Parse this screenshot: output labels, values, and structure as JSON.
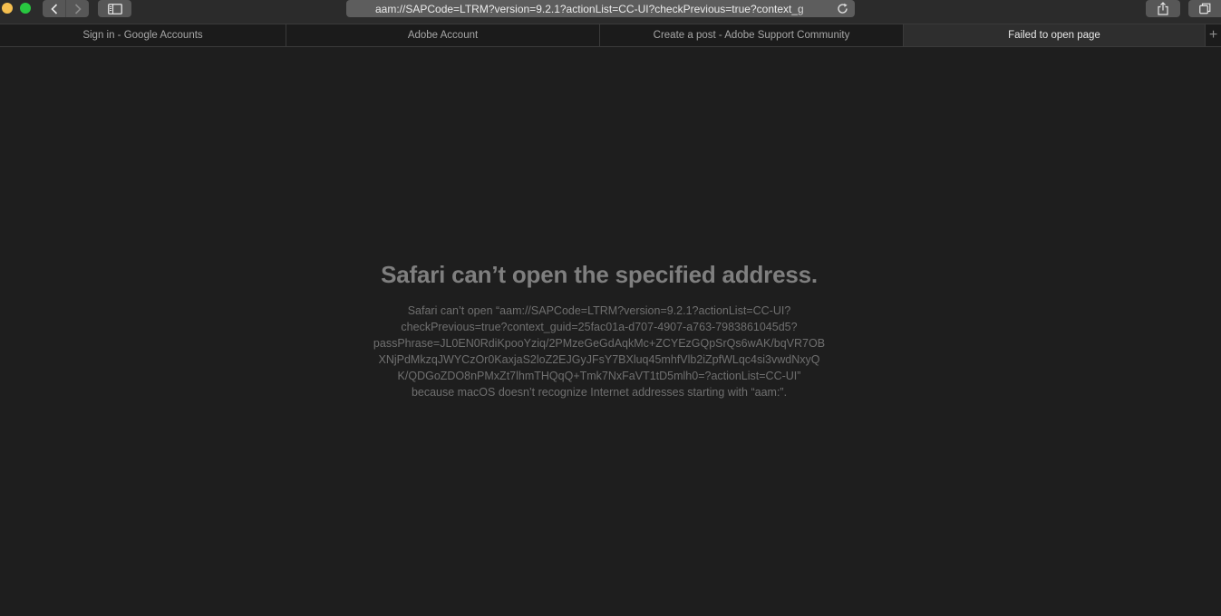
{
  "toolbar": {
    "address": "aam://SAPCode=LTRM?version=9.2.1?actionList=CC-UI?checkPrevious=true?context_g",
    "icons": {
      "back": "chevron-left-icon",
      "forward": "chevron-right-icon",
      "sidebar": "sidebar-icon",
      "reload": "reload-icon",
      "share": "share-icon",
      "tabs": "tab-overview-icon"
    }
  },
  "tabs": [
    {
      "label": "Sign in - Google Accounts",
      "active": false
    },
    {
      "label": "Adobe Account",
      "active": false
    },
    {
      "label": "Create a post - Adobe Support Community",
      "active": false
    },
    {
      "label": "Failed to open page",
      "active": true
    }
  ],
  "new_tab_label": "+",
  "error": {
    "title": "Safari can’t open the specified address.",
    "lines": [
      "Safari can’t open “aam://SAPCode=LTRM?version=9.2.1?actionList=CC-UI?",
      "checkPrevious=true?context_guid=25fac01a-d707-4907-a763-7983861045d5?",
      "passPhrase=JL0EN0RdiKpooYziq/2PMzeGeGdAqkMc+ZCYEzGQpSrQs6wAK/bqVR7OB",
      "XNjPdMkzqJWYCzOr0KaxjaS2loZ2EJGyJFsY7BXluq45mhfVlb2iZpfWLqc4si3vwdNxyQ",
      "K/QDGoZDO8nPMxZt7lhmTHQqQ+Tmk7NxFaVT1tD5mlh0=?actionList=CC-UI”",
      "because macOS doesn’t recognize Internet addresses starting with “aam:”."
    ]
  },
  "colors": {
    "background": "#1e1e1e",
    "toolbar": "#2b2b2b",
    "title_text": "#7f7f7f",
    "body_text": "#6f6f6f",
    "traffic_yellow": "#f5bf4f",
    "traffic_green": "#28c840"
  }
}
